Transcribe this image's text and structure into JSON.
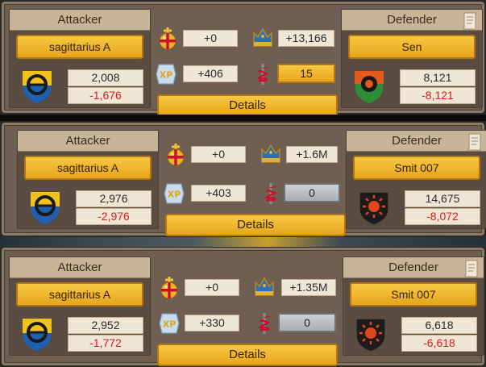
{
  "colors": {
    "panel": "#6e5f52",
    "gold": "#f2b833",
    "loss": "#d61d1d",
    "head": "#c8b496"
  },
  "icons": {
    "orb": "golden-orb-icon",
    "crown": "blue-crown-icon",
    "xp": "xp-icon",
    "caduceus": "caduceus-icon",
    "scroll": "scroll-icon"
  },
  "reports": [
    {
      "attacker": {
        "header": "Attacker",
        "name": "sagittarius A",
        "value": "2,008",
        "loss": "-1,676"
      },
      "defender": {
        "header": "Defender",
        "name": "Sen",
        "value": "8,121",
        "loss": "-8,121"
      },
      "stats": {
        "orb": "+0",
        "crown": "+13,166",
        "xp": "+406",
        "heal": "15"
      },
      "details": "Details"
    },
    {
      "attacker": {
        "header": "Attacker",
        "name": "sagittarius A",
        "value": "2,976",
        "loss": "-2,976"
      },
      "defender": {
        "header": "Defender",
        "name": "Smit 007",
        "value": "14,675",
        "loss": "-8,072"
      },
      "stats": {
        "orb": "+0",
        "crown": "+1.6M",
        "xp": "+403",
        "heal": "0"
      },
      "details": "Details"
    },
    {
      "attacker": {
        "header": "Attacker",
        "name": "sagittarius A",
        "value": "2,952",
        "loss": "-1,772"
      },
      "defender": {
        "header": "Defender",
        "name": "Smit 007",
        "value": "6,618",
        "loss": "-6,618"
      },
      "stats": {
        "orb": "+0",
        "crown": "+1.35M",
        "xp": "+330",
        "heal": "0"
      },
      "details": "Details"
    }
  ]
}
